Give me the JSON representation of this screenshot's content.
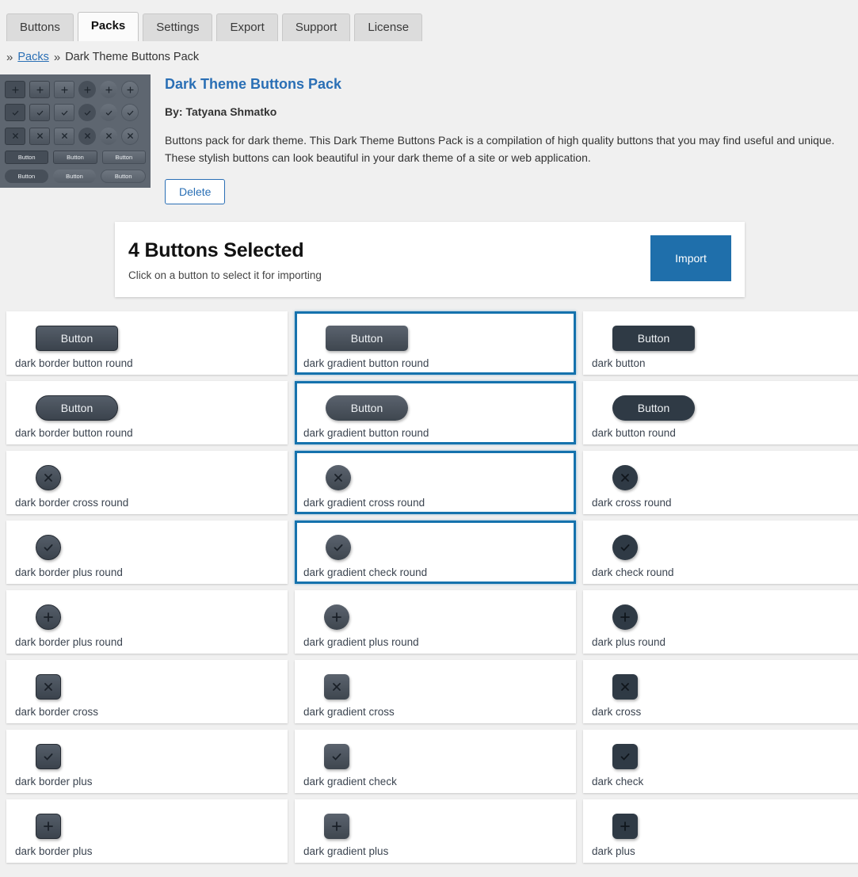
{
  "tabs": [
    {
      "label": "Buttons",
      "active": false
    },
    {
      "label": "Packs",
      "active": true
    },
    {
      "label": "Settings",
      "active": false
    },
    {
      "label": "Export",
      "active": false
    },
    {
      "label": "Support",
      "active": false
    },
    {
      "label": "License",
      "active": false
    }
  ],
  "breadcrumb": {
    "sep1": "»",
    "link": "Packs",
    "sep2": "»",
    "current": "Dark Theme Buttons Pack"
  },
  "pack": {
    "title": "Dark Theme Buttons Pack",
    "author": "By: Tatyana Shmatko",
    "description": "Buttons pack for dark theme. This Dark Theme Buttons Pack is a compilation of high quality buttons that you may find useful and unique. These stylish buttons can look beautiful in your dark theme of a site or web application.",
    "delete_label": "Delete",
    "thumbnail_button_label": "Button"
  },
  "selection": {
    "count_label": "4 Buttons Selected",
    "hint": "Click on a button to select it for importing",
    "import_label": "Import"
  },
  "colors": {
    "accent_blue": "#1f6fab",
    "selected_border": "#1572ad",
    "link_blue": "#2a6fb5",
    "dark_button": "#2f3a45",
    "page_bg": "#f0f0f0",
    "thumb_bg": "#5e6670"
  },
  "button_text": "Button",
  "cards": [
    {
      "label": "dark border button round",
      "style": "f-border",
      "shape": "sh-sq",
      "kind": "wide",
      "icon": "",
      "selected": false
    },
    {
      "label": "dark gradient button round",
      "style": "f-gradient",
      "shape": "sh-sq",
      "kind": "wide",
      "icon": "",
      "selected": true
    },
    {
      "label": "dark button",
      "style": "f-flat",
      "shape": "sh-sq",
      "kind": "wide",
      "icon": "",
      "selected": false
    },
    {
      "label": "dark border button round",
      "style": "f-border",
      "shape": "sh-pill",
      "kind": "wide",
      "icon": "",
      "selected": false
    },
    {
      "label": "dark gradient button round",
      "style": "f-gradient",
      "shape": "sh-pill",
      "kind": "wide",
      "icon": "",
      "selected": true
    },
    {
      "label": "dark button round",
      "style": "f-flat",
      "shape": "sh-pill",
      "kind": "wide",
      "icon": "",
      "selected": false
    },
    {
      "label": "dark border cross round",
      "style": "f-border",
      "shape": "sh-circ",
      "kind": "icn",
      "icon": "cross-icon",
      "selected": false
    },
    {
      "label": "dark gradient cross round",
      "style": "f-gradient",
      "shape": "sh-circ",
      "kind": "icn",
      "icon": "cross-icon",
      "selected": true
    },
    {
      "label": "dark cross round",
      "style": "f-flat",
      "shape": "sh-circ",
      "kind": "icn",
      "icon": "cross-icon",
      "selected": false
    },
    {
      "label": "dark border plus round",
      "style": "f-border",
      "shape": "sh-circ",
      "kind": "icn",
      "icon": "check-icon",
      "selected": false
    },
    {
      "label": "dark gradient check round",
      "style": "f-gradient",
      "shape": "sh-circ",
      "kind": "icn",
      "icon": "check-icon",
      "selected": true
    },
    {
      "label": "dark check round",
      "style": "f-flat",
      "shape": "sh-circ",
      "kind": "icn",
      "icon": "check-icon",
      "selected": false
    },
    {
      "label": "dark border plus round",
      "style": "f-border",
      "shape": "sh-circ",
      "kind": "icn",
      "icon": "plus-icon",
      "selected": false
    },
    {
      "label": "dark gradient plus round",
      "style": "f-gradient",
      "shape": "sh-circ",
      "kind": "icn",
      "icon": "plus-icon",
      "selected": false
    },
    {
      "label": "dark plus round",
      "style": "f-flat",
      "shape": "sh-circ",
      "kind": "icn",
      "icon": "plus-icon",
      "selected": false
    },
    {
      "label": "dark border cross",
      "style": "f-border",
      "shape": "sh-isq",
      "kind": "icn",
      "icon": "cross-icon",
      "selected": false
    },
    {
      "label": "dark gradient cross",
      "style": "f-gradient",
      "shape": "sh-isq",
      "kind": "icn",
      "icon": "cross-icon",
      "selected": false
    },
    {
      "label": "dark cross",
      "style": "f-flat",
      "shape": "sh-isq",
      "kind": "icn",
      "icon": "cross-icon",
      "selected": false
    },
    {
      "label": "dark border plus",
      "style": "f-border",
      "shape": "sh-isq",
      "kind": "icn",
      "icon": "check-icon",
      "selected": false
    },
    {
      "label": "dark gradient check",
      "style": "f-gradient",
      "shape": "sh-isq",
      "kind": "icn",
      "icon": "check-icon",
      "selected": false
    },
    {
      "label": "dark check",
      "style": "f-flat",
      "shape": "sh-isq",
      "kind": "icn",
      "icon": "check-icon",
      "selected": false
    },
    {
      "label": "dark border plus",
      "style": "f-border",
      "shape": "sh-isq",
      "kind": "icn",
      "icon": "plus-icon",
      "selected": false
    },
    {
      "label": "dark gradient plus",
      "style": "f-gradient",
      "shape": "sh-isq",
      "kind": "icn",
      "icon": "plus-icon",
      "selected": false
    },
    {
      "label": "dark plus",
      "style": "f-flat",
      "shape": "sh-isq",
      "kind": "icn",
      "icon": "plus-icon",
      "selected": false
    }
  ],
  "thumbnail": {
    "icon_rows": [
      {
        "icon": "plus-icon",
        "cells": [
          "t-b1 sq",
          "t-b2 sq",
          "t-b3 sq",
          "t-b4 rd",
          "t-b5 rd",
          "t-b6 rd"
        ]
      },
      {
        "icon": "check-icon",
        "cells": [
          "t-b1 sq",
          "t-b2 sq",
          "t-b3 sq",
          "t-b4 rd",
          "t-b5 rd",
          "t-b6 rd"
        ]
      },
      {
        "icon": "cross-icon",
        "cells": [
          "t-b1 sq",
          "t-b2 sq",
          "t-b3 sq",
          "t-b4 rd",
          "t-b5 rd",
          "t-b6 rd"
        ]
      }
    ],
    "button_rows": [
      [
        "t-b1 sq",
        "t-b2 sq",
        "t-b3 sq"
      ],
      [
        "t-b4 rd",
        "t-b5 rd",
        "t-b6 rd"
      ]
    ]
  }
}
